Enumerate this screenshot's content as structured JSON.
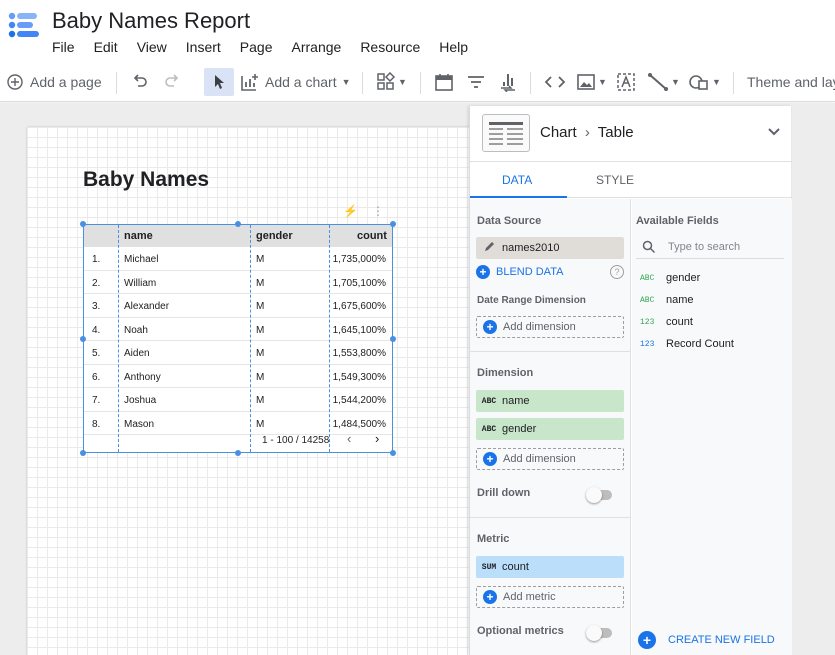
{
  "app": {
    "title": "Baby Names Report",
    "menu": [
      "File",
      "Edit",
      "View",
      "Insert",
      "Page",
      "Arrange",
      "Resource",
      "Help"
    ]
  },
  "toolbar": {
    "add_page": "Add a page",
    "add_chart": "Add a chart",
    "theme": "Theme and layout"
  },
  "report": {
    "page_title": "Baby Names",
    "table": {
      "columns": [
        "name",
        "gender",
        "count"
      ],
      "rows": [
        [
          "1.",
          "Michael",
          "M",
          "1,735,000%"
        ],
        [
          "2.",
          "William",
          "M",
          "1,705,100%"
        ],
        [
          "3.",
          "Alexander",
          "M",
          "1,675,600%"
        ],
        [
          "4.",
          "Noah",
          "M",
          "1,645,100%"
        ],
        [
          "5.",
          "Aiden",
          "M",
          "1,553,800%"
        ],
        [
          "6.",
          "Anthony",
          "M",
          "1,549,300%"
        ],
        [
          "7.",
          "Joshua",
          "M",
          "1,544,200%"
        ],
        [
          "8.",
          "Mason",
          "M",
          "1,484,500%"
        ]
      ],
      "pagination": "1 - 100 / 14258"
    }
  },
  "panel": {
    "header": {
      "chart": "Chart",
      "sep": "›",
      "type": "Table"
    },
    "tabs": [
      "DATA",
      "STYLE"
    ],
    "data_source_label": "Data Source",
    "data_source": "names2010",
    "blend_data": "BLEND DATA",
    "date_range_label": "Date Range Dimension",
    "add_dimension": "Add dimension",
    "dimension_label": "Dimension",
    "dimensions": [
      {
        "type": "ABC",
        "name": "name"
      },
      {
        "type": "ABC",
        "name": "gender"
      }
    ],
    "drill_down": "Drill down",
    "metric_label": "Metric",
    "metrics": [
      {
        "type": "SUM",
        "name": "count"
      }
    ],
    "add_metric": "Add metric",
    "optional_metrics": "Optional metrics",
    "available_fields_label": "Available Fields",
    "search_placeholder": "Type to search",
    "fields": [
      {
        "type": "ABC",
        "name": "gender"
      },
      {
        "type": "ABC",
        "name": "name"
      },
      {
        "type": "123",
        "name": "count"
      },
      {
        "type": "123",
        "name": "Record Count"
      }
    ],
    "create_new_field": "CREATE NEW FIELD"
  },
  "colors": {
    "accent": "#1a73e8",
    "dimension_chip": "#c8e6c9",
    "metric_chip": "#bbdefb",
    "selection": "#4a90e2"
  }
}
